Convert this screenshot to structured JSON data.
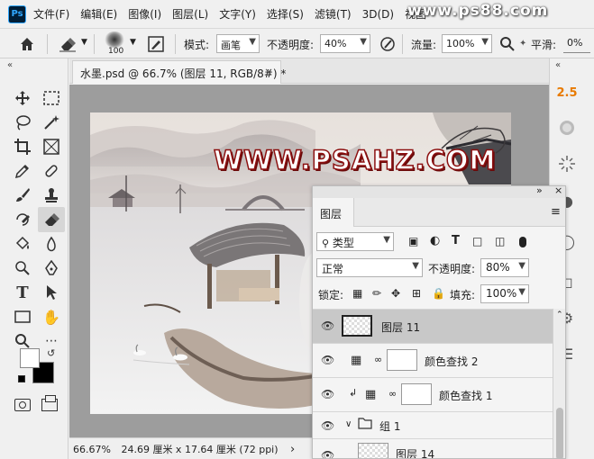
{
  "app": {
    "logo": "Ps"
  },
  "menu": [
    "文件(F)",
    "编辑(E)",
    "图像(I)",
    "图层(L)",
    "文字(Y)",
    "选择(S)",
    "滤镜(T)",
    "3D(D)",
    "视图"
  ],
  "watermark": "www.ps88.com",
  "options": {
    "brush_size": "100",
    "mode_label": "模式:",
    "mode_value": "画笔",
    "opacity_label": "不透明度:",
    "opacity_value": "40%",
    "flow_label": "流量:",
    "flow_value": "100%",
    "smooth_label": "平滑:",
    "smooth_value": "0%"
  },
  "document": {
    "tab_title": "水墨.psd @ 66.7% (图层 11, RGB/8#) *",
    "close": "×",
    "artwork_title": "WWW.PSAHZ.COM"
  },
  "status": {
    "zoom": "66.67%",
    "size": "24.69 厘米 x 17.64 厘米 (72 ppi)",
    "arrow": "›"
  },
  "dock": {
    "value": "2.5"
  },
  "layers_panel": {
    "tab": "图层",
    "filter_kind": "类型",
    "blend_mode": "正常",
    "opacity_label": "不透明度:",
    "opacity_value": "80%",
    "lock_label": "锁定:",
    "fill_label": "填充:",
    "fill_value": "100%",
    "layers": [
      {
        "name": "图层 11",
        "type": "pixel",
        "selected": true
      },
      {
        "name": "颜色查找 2",
        "type": "adjustment",
        "selected": false
      },
      {
        "name": "颜色查找 1",
        "type": "adjustment",
        "clipped": true,
        "selected": false
      },
      {
        "name": "组 1",
        "type": "group",
        "selected": false
      },
      {
        "name": "图层 14",
        "type": "pixel",
        "selected": false
      }
    ]
  },
  "colors": {
    "accent_orange": "#e87a00",
    "selected_row": "#c8c8c8",
    "title_stroke": "#8c1010"
  }
}
